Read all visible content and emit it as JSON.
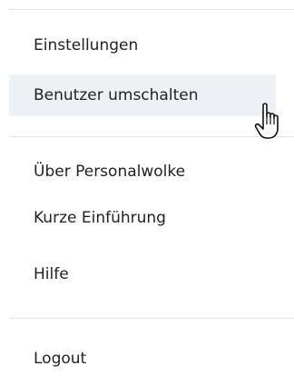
{
  "menu": {
    "groups": [
      {
        "items": [
          {
            "label": "Einstellungen"
          },
          {
            "label": "Benutzer umschalten",
            "hovered": true
          }
        ]
      },
      {
        "items": [
          {
            "label": "Über Personalwolke"
          },
          {
            "label": "Kurze Einführung"
          },
          {
            "label": "Hilfe"
          }
        ]
      },
      {
        "items": [
          {
            "label": "Logout"
          }
        ]
      }
    ]
  },
  "colors": {
    "text": "#222222",
    "hover_background": "#edf0f5",
    "divider": "#e4e4e4"
  },
  "cursor": {
    "icon": "hand-pointer-icon"
  }
}
